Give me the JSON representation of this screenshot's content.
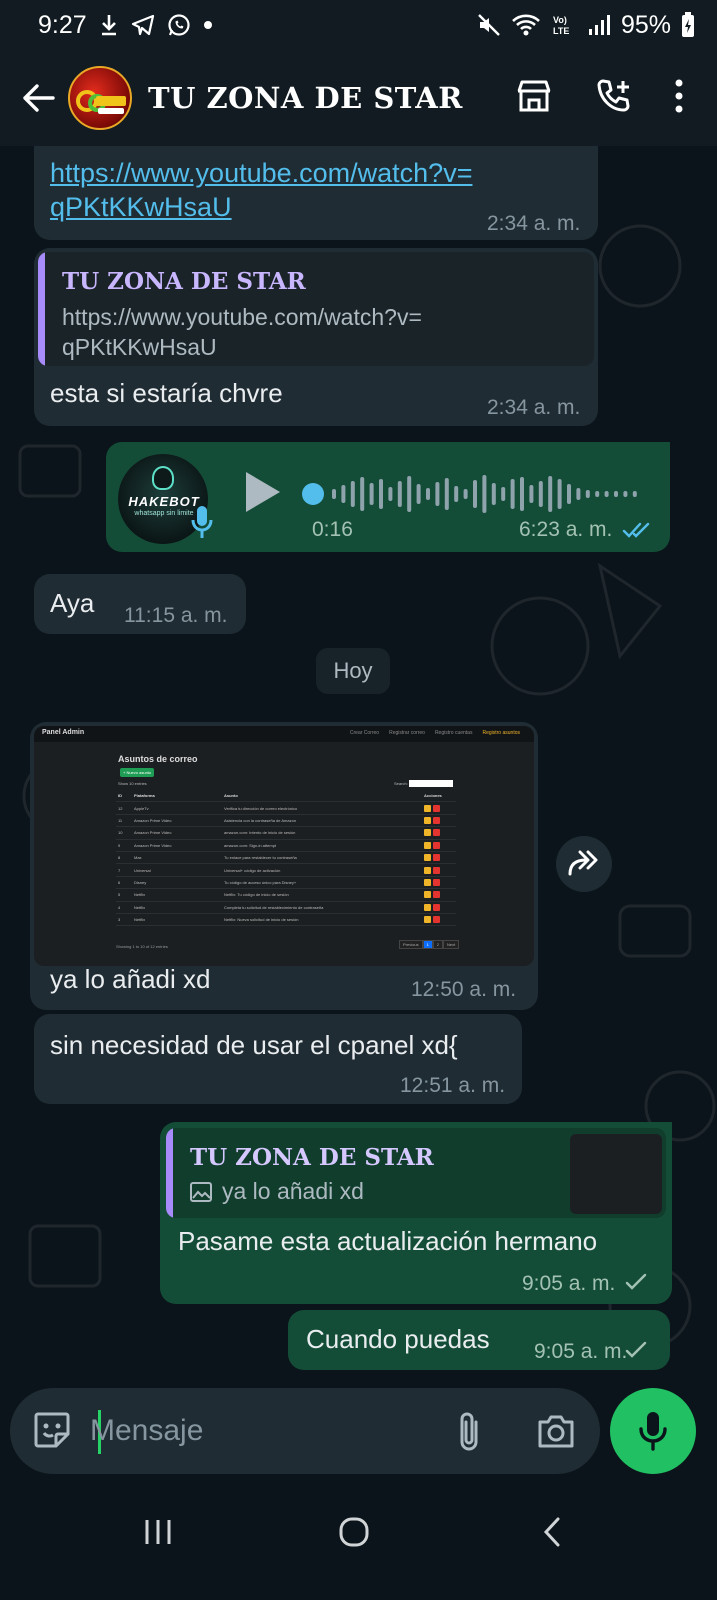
{
  "status_bar": {
    "time": "9:27",
    "battery": "95%"
  },
  "header": {
    "title": "TU ZONA DE STAR"
  },
  "messages": {
    "m1": {
      "link_line1": "https://www.youtube.com/watch?v=",
      "link_line2": "qPKtKKwHsaU",
      "time": "2:34 a. m."
    },
    "m2": {
      "quote_name": "TU ZONA DE STAR",
      "quote_line1": "https://www.youtube.com/watch?v=",
      "quote_line2": "qPKtKKwHsaU",
      "text": "esta si estaría chvre",
      "time": "2:34 a. m."
    },
    "m3": {
      "duration": "0:16",
      "time": "6:23 a. m.",
      "avatar_text": "HAKEBOT",
      "avatar_sub": "whatsapp sin limite"
    },
    "m4": {
      "text": "Aya",
      "time": "11:15 a. m."
    },
    "day_chip": "Hoy",
    "m5": {
      "text": "ya lo añadi xd",
      "time": "12:50 a. m."
    },
    "m6": {
      "text": "sin necesidad de usar el cpanel xd{",
      "time": "12:51 a. m."
    },
    "m7": {
      "quote_name": "TU ZONA DE STAR",
      "quote_text": "ya lo añadi xd",
      "text": "Pasame esta actualización hermano",
      "time": "9:05 a. m."
    },
    "m8": {
      "text": "Cuando puedas",
      "time": "9:05 a. m."
    }
  },
  "screenshot": {
    "panel_title": "Panel Admin",
    "nav_links": [
      "Crear Correo",
      "Registrar correo",
      "Registro cuentas",
      "Registro asuntos"
    ],
    "heading": "Asuntos de correo",
    "new_button": "+ Nuevo asunto",
    "show_label": "Show 10 entries",
    "search_label": "Search:",
    "columns": [
      "ID",
      "Plataforma",
      "Asunto",
      "Acciones"
    ],
    "rows": [
      [
        "12",
        "AppleTv",
        "Verifica tu dirección de correo electrónico"
      ],
      [
        "11",
        "Amazon Prime Video",
        "Asistencia con la contraseña de Amazon"
      ],
      [
        "10",
        "Amazon Prime Video",
        "amazon.com: Intento de inicio de sesión"
      ],
      [
        "9",
        "Amazon Prime Video",
        "amazon.com: Sign-in attempt"
      ],
      [
        "8",
        "Max",
        "Tu enlace para restablecer tu contraseña"
      ],
      [
        "7",
        "Universal",
        "Universal+ código de activación"
      ],
      [
        "6",
        "Disney",
        "Tu código de acceso único para Disney+"
      ],
      [
        "5",
        "Netflix",
        "Netflix: Tu código de inicio de sesión"
      ],
      [
        "4",
        "Netflix",
        "Completa tu solicitud de restablecimiento de contraseña"
      ],
      [
        "3",
        "Netflix",
        "Netflix: Nueva solicitud de inicio de sesión"
      ]
    ],
    "footer": "Showing 1 to 10 of 12 entries",
    "pager": [
      "Previous",
      "1",
      "2",
      "Next"
    ]
  },
  "composer": {
    "placeholder": "Mensaje"
  },
  "colors": {
    "incoming": "#202c33",
    "outgoing": "#144d37",
    "accent": "#21c063",
    "link": "#53bdeb",
    "read_ticks": "#53bdeb"
  }
}
